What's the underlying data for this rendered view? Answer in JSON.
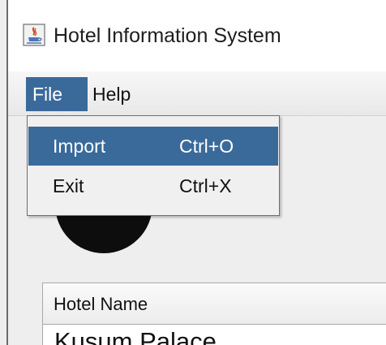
{
  "window": {
    "title": "Hotel Information System",
    "icon": "java-cup-icon"
  },
  "menu_bar": {
    "items": [
      {
        "label": "File",
        "state": "open"
      },
      {
        "label": "Help",
        "state": "closed"
      }
    ]
  },
  "file_menu": {
    "items": [
      {
        "label": "Import",
        "accelerator": "Ctrl+O",
        "highlighted": true
      },
      {
        "label": "Exit",
        "accelerator": "Ctrl+X",
        "highlighted": false
      }
    ]
  },
  "table": {
    "columns": [
      "Hotel Name"
    ],
    "rows": [
      [
        "Kusum Palace"
      ]
    ]
  },
  "colors": {
    "menu_highlight": "#3a6a9a",
    "window_bg": "#eeeeee"
  }
}
